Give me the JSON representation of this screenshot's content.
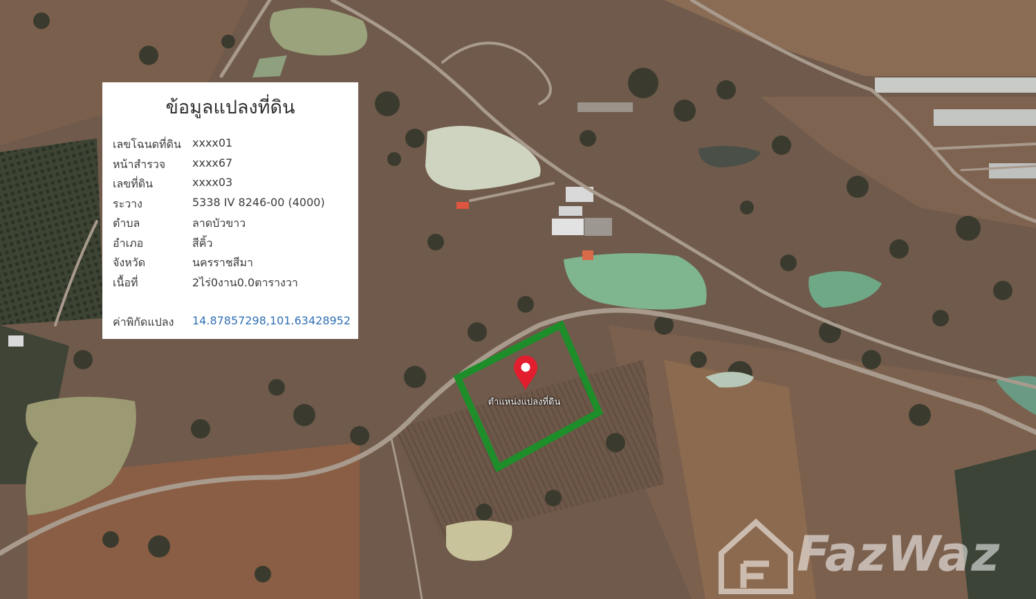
{
  "info_card": {
    "title": "ข้อมูลแปลงที่ดิน",
    "rows": [
      {
        "label": "เลขโฉนดที่ดิน",
        "value": "xxxx01"
      },
      {
        "label": "หน้าสำรวจ",
        "value": "xxxx67"
      },
      {
        "label": "เลขที่ดิน",
        "value": "xxxx03"
      },
      {
        "label": "ระวาง",
        "value": "5338 IV 8246-00 (4000)"
      },
      {
        "label": "ตำบล",
        "value": "ลาดบัวขาว"
      },
      {
        "label": "อำเภอ",
        "value": "สีคิ้ว"
      },
      {
        "label": "จังหวัด",
        "value": "นครราชสีมา"
      },
      {
        "label": "เนื้อที่",
        "value": "2ไร่0งาน0.0ตารางวา"
      }
    ],
    "coordinates": {
      "label": "ค่าพิกัดแปลง",
      "value": "14.87857298,101.63428952"
    }
  },
  "map": {
    "marker_label": "ตำแหน่งแปลงที่ดิน",
    "parcel_outline_color": "#1e8e2a",
    "marker_color": "#e11d2e",
    "link_color": "#2f6fb4"
  },
  "watermark": {
    "text": "FazWaz"
  }
}
